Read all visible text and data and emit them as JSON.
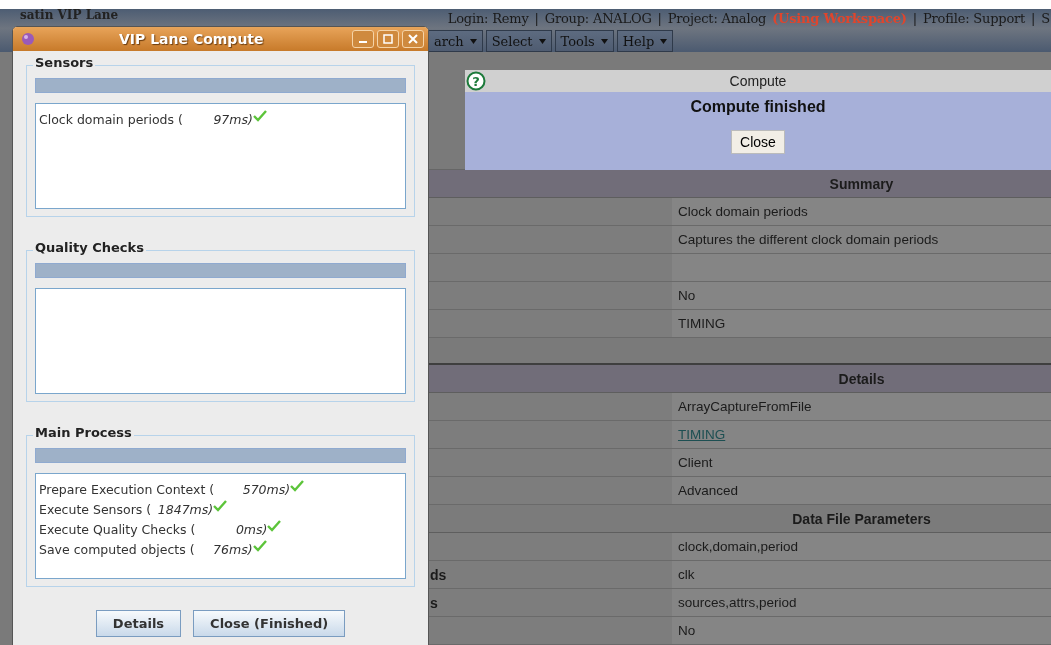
{
  "app": {
    "title": "satin VIP Lane",
    "user_info": [
      {
        "text": "Login: Remy",
        "highlight": false
      },
      {
        "text": "|",
        "highlight": false
      },
      {
        "text": "Group: ANALOG",
        "highlight": false
      },
      {
        "text": "|",
        "highlight": false
      },
      {
        "text": "Project: Analog",
        "highlight": false
      },
      {
        "text": "(Using Workspace)",
        "highlight": true
      },
      {
        "text": "|",
        "highlight": false
      },
      {
        "text": "Profile: Support",
        "highlight": false
      },
      {
        "text": "|",
        "highlight": false
      },
      {
        "text": "S",
        "highlight": false
      }
    ],
    "menus": [
      "arch",
      "Select",
      "Tools",
      "Help"
    ]
  },
  "notification": {
    "help_glyph": "?",
    "title": "Compute",
    "message": "Compute finished",
    "button": "Close"
  },
  "table": {
    "rows": [
      {
        "kind": "header",
        "value": "Summary"
      },
      {
        "kind": "row",
        "value": "Clock domain periods"
      },
      {
        "kind": "row",
        "value": "Captures the different clock domain periods"
      },
      {
        "kind": "row"
      },
      {
        "kind": "row",
        "value": "No"
      },
      {
        "kind": "row",
        "value": "TIMING"
      },
      {
        "kind": "spacer"
      },
      {
        "kind": "header",
        "value": "Details"
      },
      {
        "kind": "row",
        "value": "ArrayCaptureFromFile"
      },
      {
        "kind": "link",
        "value": "TIMING"
      },
      {
        "kind": "row",
        "value": "Client"
      },
      {
        "kind": "row",
        "value": "Advanced"
      },
      {
        "kind": "header",
        "value": "Data File Parameters"
      },
      {
        "kind": "row",
        "value": "clock,domain,period"
      },
      {
        "kind": "row",
        "label": "ds",
        "value": "clk"
      },
      {
        "kind": "row",
        "label": "s",
        "value": "sources,attrs,period"
      },
      {
        "kind": "row",
        "value": "No"
      }
    ]
  },
  "dialog": {
    "title": "VIP Lane Compute",
    "groups": [
      {
        "title": "Sensors",
        "level": 1,
        "entries": [
          {
            "name": "Clock domain periods (",
            "time": "97ms)",
            "done": true
          }
        ]
      },
      {
        "title": "Quality Checks",
        "level": 1
      },
      {
        "title": "Main Process",
        "level": 1,
        "entries": [
          {
            "name": "Prepare Execution Context (",
            "time": "570ms)",
            "done": true
          },
          {
            "name": "Execute Sensors (",
            "time": "1847ms)",
            "done": true
          },
          {
            "name": "Execute Quality Checks (",
            "time": "0ms)",
            "done": true
          },
          {
            "name": "Save computed objects (",
            "time": "76ms)",
            "done": true
          }
        ]
      }
    ],
    "buttons": [
      "Details",
      "Close (Finished)"
    ]
  }
}
